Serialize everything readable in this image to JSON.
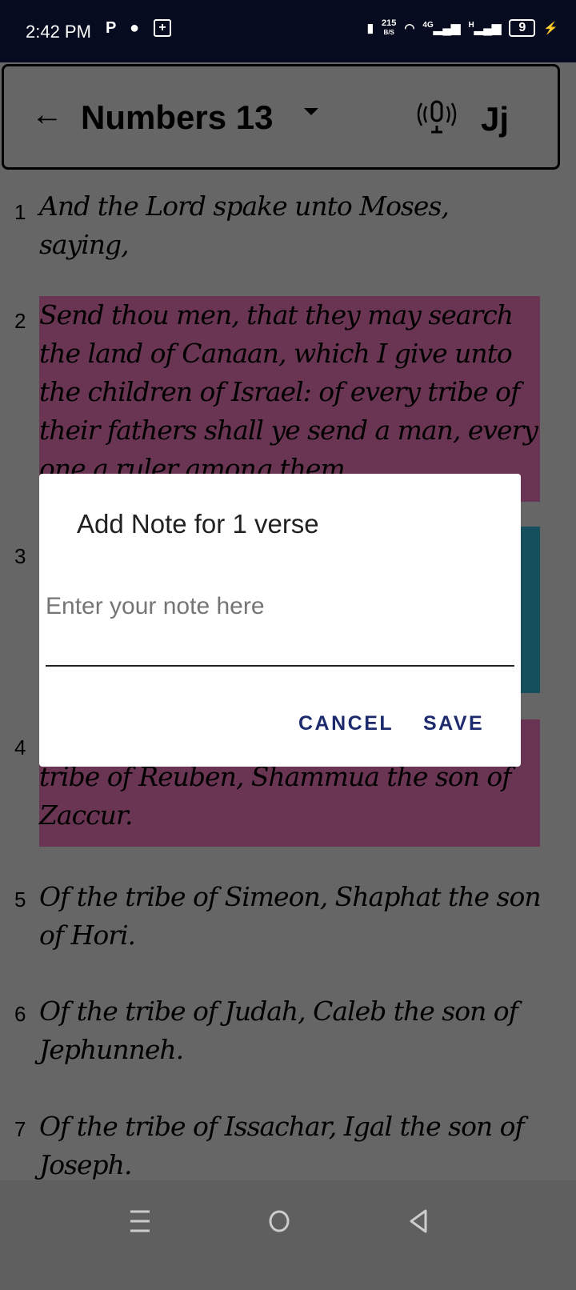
{
  "status_bar": {
    "time": "2:42 PM",
    "net_speed": "215",
    "net_unit": "B/S",
    "net_4g": "4G",
    "net_h": "H",
    "battery": "9"
  },
  "toolbar": {
    "title": "Numbers 13",
    "font_button": "Jj"
  },
  "verses": [
    {
      "num": "1",
      "text": "And the Lord spake unto Moses, saying,"
    },
    {
      "num": "2",
      "text": "Send thou men, that they may search the land of Canaan, which I give unto the children of Israel: of every tribe of their fathers shall ye send a man, every one a ruler among them."
    },
    {
      "num": "3",
      "text": ""
    },
    {
      "num": "4",
      "text": "tribe of Reuben, Shammua the son of Zaccur."
    },
    {
      "num": "5",
      "text": "Of the tribe of Simeon, Shaphat the son of Hori."
    },
    {
      "num": "6",
      "text": "Of the tribe of Judah, Caleb the son of Jephunneh."
    },
    {
      "num": "7",
      "text": "Of the tribe of Issachar, Igal the son of Joseph."
    }
  ],
  "dialog": {
    "title": "Add Note for 1 verse",
    "placeholder": "Enter your note here",
    "value": "",
    "cancel": "CANCEL",
    "save": "SAVE"
  },
  "colors": {
    "highlight_pink": "#6a3552",
    "highlight_teal": "#154f5e",
    "button": "#1d2a6e"
  }
}
